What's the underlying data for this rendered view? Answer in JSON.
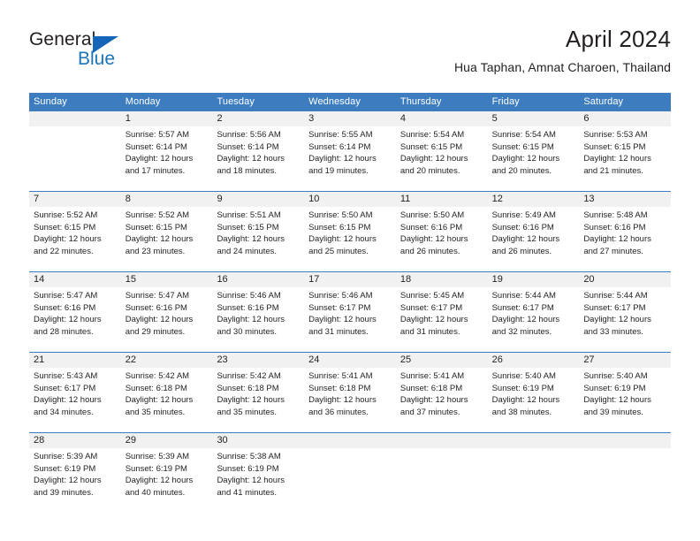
{
  "logo": {
    "word1": "General",
    "word2": "Blue",
    "triangle_color": "#1565b8",
    "blue_color": "#1b75bb"
  },
  "header": {
    "title": "April 2024",
    "subtitle": "Hua Taphan, Amnat Charoen, Thailand"
  },
  "theme": {
    "header_bg": "#3d7dbf",
    "daynum_bg": "#f1f1f1",
    "text": "#231f20"
  },
  "weekdays": [
    "Sunday",
    "Monday",
    "Tuesday",
    "Wednesday",
    "Thursday",
    "Friday",
    "Saturday"
  ],
  "labels": {
    "sunrise": "Sunrise:",
    "sunset": "Sunset:",
    "daylight": "Daylight:"
  },
  "weeks": [
    {
      "days": [
        {
          "num": "",
          "sunrise": "",
          "sunset": "",
          "daylight_1": "",
          "daylight_2": "",
          "empty": true
        },
        {
          "num": "1",
          "sunrise": "Sunrise: 5:57 AM",
          "sunset": "Sunset: 6:14 PM",
          "daylight_1": "Daylight: 12 hours",
          "daylight_2": "and 17 minutes."
        },
        {
          "num": "2",
          "sunrise": "Sunrise: 5:56 AM",
          "sunset": "Sunset: 6:14 PM",
          "daylight_1": "Daylight: 12 hours",
          "daylight_2": "and 18 minutes."
        },
        {
          "num": "3",
          "sunrise": "Sunrise: 5:55 AM",
          "sunset": "Sunset: 6:14 PM",
          "daylight_1": "Daylight: 12 hours",
          "daylight_2": "and 19 minutes."
        },
        {
          "num": "4",
          "sunrise": "Sunrise: 5:54 AM",
          "sunset": "Sunset: 6:15 PM",
          "daylight_1": "Daylight: 12 hours",
          "daylight_2": "and 20 minutes."
        },
        {
          "num": "5",
          "sunrise": "Sunrise: 5:54 AM",
          "sunset": "Sunset: 6:15 PM",
          "daylight_1": "Daylight: 12 hours",
          "daylight_2": "and 20 minutes."
        },
        {
          "num": "6",
          "sunrise": "Sunrise: 5:53 AM",
          "sunset": "Sunset: 6:15 PM",
          "daylight_1": "Daylight: 12 hours",
          "daylight_2": "and 21 minutes."
        }
      ]
    },
    {
      "days": [
        {
          "num": "7",
          "sunrise": "Sunrise: 5:52 AM",
          "sunset": "Sunset: 6:15 PM",
          "daylight_1": "Daylight: 12 hours",
          "daylight_2": "and 22 minutes."
        },
        {
          "num": "8",
          "sunrise": "Sunrise: 5:52 AM",
          "sunset": "Sunset: 6:15 PM",
          "daylight_1": "Daylight: 12 hours",
          "daylight_2": "and 23 minutes."
        },
        {
          "num": "9",
          "sunrise": "Sunrise: 5:51 AM",
          "sunset": "Sunset: 6:15 PM",
          "daylight_1": "Daylight: 12 hours",
          "daylight_2": "and 24 minutes."
        },
        {
          "num": "10",
          "sunrise": "Sunrise: 5:50 AM",
          "sunset": "Sunset: 6:15 PM",
          "daylight_1": "Daylight: 12 hours",
          "daylight_2": "and 25 minutes."
        },
        {
          "num": "11",
          "sunrise": "Sunrise: 5:50 AM",
          "sunset": "Sunset: 6:16 PM",
          "daylight_1": "Daylight: 12 hours",
          "daylight_2": "and 26 minutes."
        },
        {
          "num": "12",
          "sunrise": "Sunrise: 5:49 AM",
          "sunset": "Sunset: 6:16 PM",
          "daylight_1": "Daylight: 12 hours",
          "daylight_2": "and 26 minutes."
        },
        {
          "num": "13",
          "sunrise": "Sunrise: 5:48 AM",
          "sunset": "Sunset: 6:16 PM",
          "daylight_1": "Daylight: 12 hours",
          "daylight_2": "and 27 minutes."
        }
      ]
    },
    {
      "days": [
        {
          "num": "14",
          "sunrise": "Sunrise: 5:47 AM",
          "sunset": "Sunset: 6:16 PM",
          "daylight_1": "Daylight: 12 hours",
          "daylight_2": "and 28 minutes."
        },
        {
          "num": "15",
          "sunrise": "Sunrise: 5:47 AM",
          "sunset": "Sunset: 6:16 PM",
          "daylight_1": "Daylight: 12 hours",
          "daylight_2": "and 29 minutes."
        },
        {
          "num": "16",
          "sunrise": "Sunrise: 5:46 AM",
          "sunset": "Sunset: 6:16 PM",
          "daylight_1": "Daylight: 12 hours",
          "daylight_2": "and 30 minutes."
        },
        {
          "num": "17",
          "sunrise": "Sunrise: 5:46 AM",
          "sunset": "Sunset: 6:17 PM",
          "daylight_1": "Daylight: 12 hours",
          "daylight_2": "and 31 minutes."
        },
        {
          "num": "18",
          "sunrise": "Sunrise: 5:45 AM",
          "sunset": "Sunset: 6:17 PM",
          "daylight_1": "Daylight: 12 hours",
          "daylight_2": "and 31 minutes."
        },
        {
          "num": "19",
          "sunrise": "Sunrise: 5:44 AM",
          "sunset": "Sunset: 6:17 PM",
          "daylight_1": "Daylight: 12 hours",
          "daylight_2": "and 32 minutes."
        },
        {
          "num": "20",
          "sunrise": "Sunrise: 5:44 AM",
          "sunset": "Sunset: 6:17 PM",
          "daylight_1": "Daylight: 12 hours",
          "daylight_2": "and 33 minutes."
        }
      ]
    },
    {
      "days": [
        {
          "num": "21",
          "sunrise": "Sunrise: 5:43 AM",
          "sunset": "Sunset: 6:17 PM",
          "daylight_1": "Daylight: 12 hours",
          "daylight_2": "and 34 minutes."
        },
        {
          "num": "22",
          "sunrise": "Sunrise: 5:42 AM",
          "sunset": "Sunset: 6:18 PM",
          "daylight_1": "Daylight: 12 hours",
          "daylight_2": "and 35 minutes."
        },
        {
          "num": "23",
          "sunrise": "Sunrise: 5:42 AM",
          "sunset": "Sunset: 6:18 PM",
          "daylight_1": "Daylight: 12 hours",
          "daylight_2": "and 35 minutes."
        },
        {
          "num": "24",
          "sunrise": "Sunrise: 5:41 AM",
          "sunset": "Sunset: 6:18 PM",
          "daylight_1": "Daylight: 12 hours",
          "daylight_2": "and 36 minutes."
        },
        {
          "num": "25",
          "sunrise": "Sunrise: 5:41 AM",
          "sunset": "Sunset: 6:18 PM",
          "daylight_1": "Daylight: 12 hours",
          "daylight_2": "and 37 minutes."
        },
        {
          "num": "26",
          "sunrise": "Sunrise: 5:40 AM",
          "sunset": "Sunset: 6:19 PM",
          "daylight_1": "Daylight: 12 hours",
          "daylight_2": "and 38 minutes."
        },
        {
          "num": "27",
          "sunrise": "Sunrise: 5:40 AM",
          "sunset": "Sunset: 6:19 PM",
          "daylight_1": "Daylight: 12 hours",
          "daylight_2": "and 39 minutes."
        }
      ]
    },
    {
      "days": [
        {
          "num": "28",
          "sunrise": "Sunrise: 5:39 AM",
          "sunset": "Sunset: 6:19 PM",
          "daylight_1": "Daylight: 12 hours",
          "daylight_2": "and 39 minutes."
        },
        {
          "num": "29",
          "sunrise": "Sunrise: 5:39 AM",
          "sunset": "Sunset: 6:19 PM",
          "daylight_1": "Daylight: 12 hours",
          "daylight_2": "and 40 minutes."
        },
        {
          "num": "30",
          "sunrise": "Sunrise: 5:38 AM",
          "sunset": "Sunset: 6:19 PM",
          "daylight_1": "Daylight: 12 hours",
          "daylight_2": "and 41 minutes."
        },
        {
          "num": "",
          "sunrise": "",
          "sunset": "",
          "daylight_1": "",
          "daylight_2": "",
          "empty": true
        },
        {
          "num": "",
          "sunrise": "",
          "sunset": "",
          "daylight_1": "",
          "daylight_2": "",
          "empty": true
        },
        {
          "num": "",
          "sunrise": "",
          "sunset": "",
          "daylight_1": "",
          "daylight_2": "",
          "empty": true
        },
        {
          "num": "",
          "sunrise": "",
          "sunset": "",
          "daylight_1": "",
          "daylight_2": "",
          "empty": true
        }
      ]
    }
  ]
}
